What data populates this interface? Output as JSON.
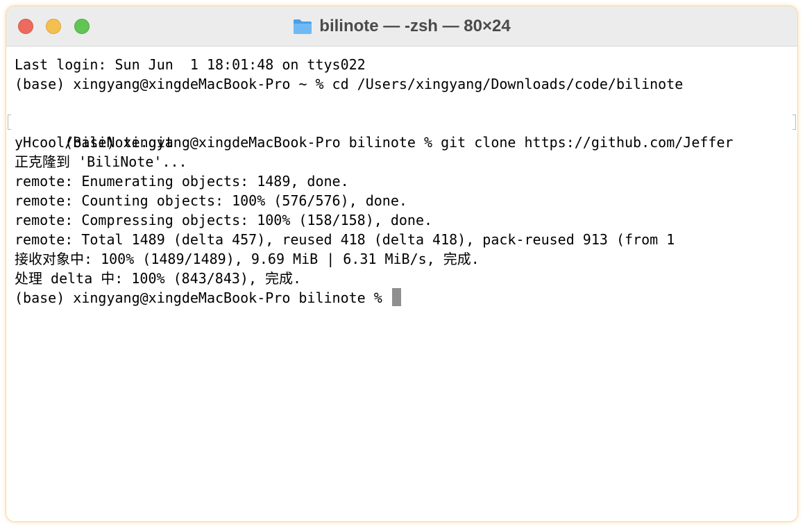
{
  "window": {
    "title": "bilinote — -zsh — 80×24",
    "folder_icon": "folder-icon"
  },
  "terminal": {
    "lines": [
      "Last login: Sun Jun  1 18:01:48 on ttys022",
      "(base) xingyang@xingdeMacBook-Pro ~ % cd /Users/xingyang/Downloads/code/bilinote",
      "",
      "(base) xingyang@xingdeMacBook-Pro bilinote % git clone https://github.com/Jeffer",
      "yHcool/BiliNote.git",
      "正克隆到 'BiliNote'...",
      "remote: Enumerating objects: 1489, done.",
      "remote: Counting objects: 100% (576/576), done.",
      "remote: Compressing objects: 100% (158/158), done.",
      "remote: Total 1489 (delta 457), reused 418 (delta 418), pack-reused 913 (from 1",
      "接收对象中: 100% (1489/1489), 9.69 MiB | 6.31 MiB/s, 完成.",
      "处理 delta 中: 100% (843/843), 完成.",
      "(base) xingyang@xingdeMacBook-Pro bilinote % "
    ]
  },
  "colors": {
    "titlebar": "#ececec",
    "close": "#ed6a5e",
    "minimize": "#f5bf4f",
    "zoom": "#61c554",
    "cursor": "#8f8f8f",
    "folder": "#5aaef0"
  }
}
